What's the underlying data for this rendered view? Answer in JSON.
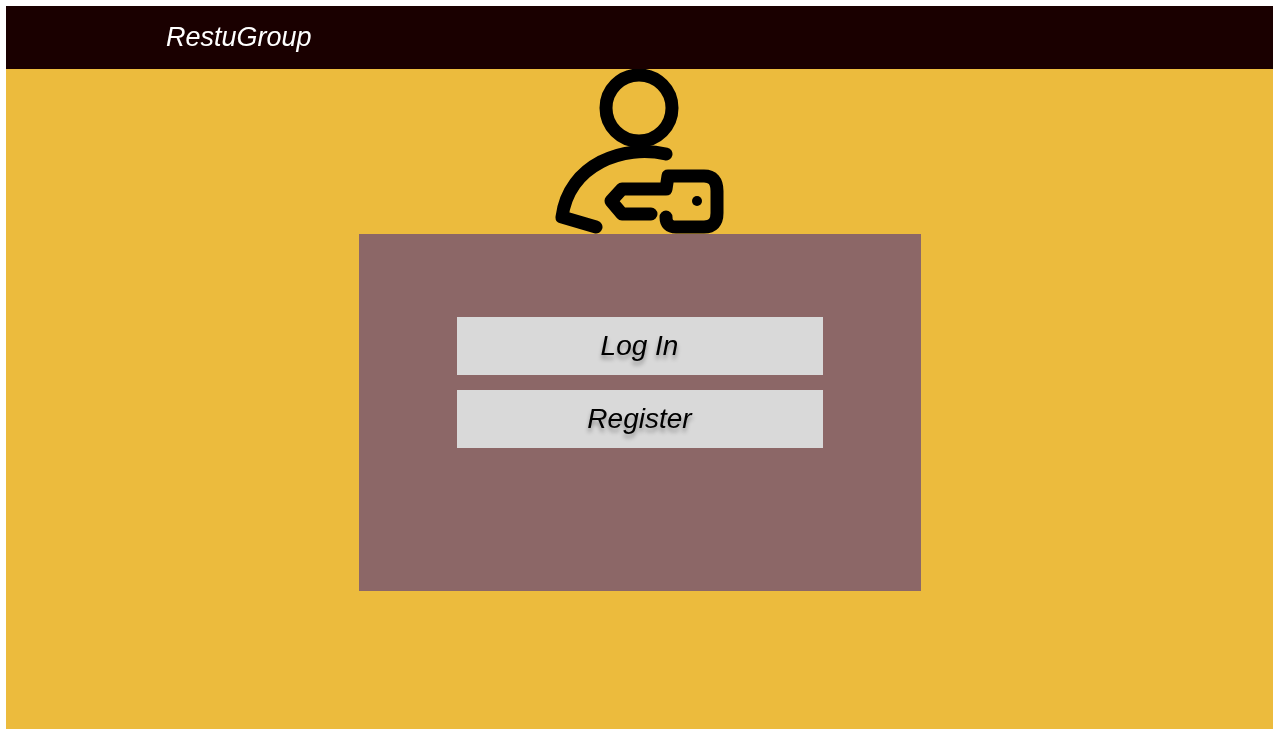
{
  "header": {
    "title": "RestuGroup"
  },
  "buttons": [
    {
      "label": "Log In"
    },
    {
      "label": "Register"
    }
  ]
}
